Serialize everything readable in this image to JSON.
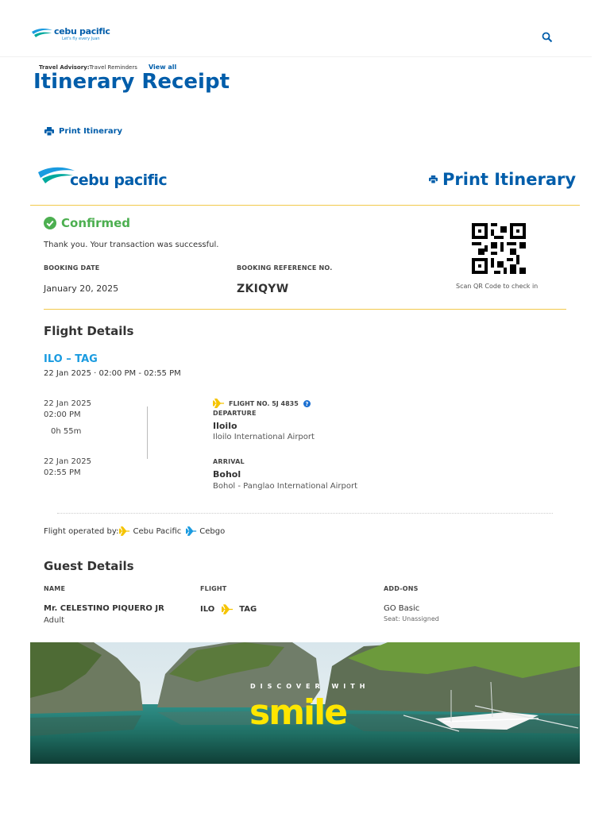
{
  "header": {
    "brand_name": "cebu pacific",
    "brand_tagline": "Let's fly every Juan",
    "advisory_label": "Travel Advisory:",
    "advisory_text": "Travel Reminders",
    "view_all": "View all",
    "brand_color": "#005DAA"
  },
  "page": {
    "title": "Itinerary Receipt",
    "print_link": "Print Itinerary",
    "print_big": "Print Itinerary",
    "brand_name": "cebu pacific"
  },
  "status": {
    "label": "Confirmed",
    "message": "Thank you. Your transaction was successful.",
    "color": "#4CAF50"
  },
  "booking": {
    "date_label": "BOOKING DATE",
    "date": "January 20, 2025",
    "ref_label": "BOOKING REFERENCE NO.",
    "ref": "ZKIQYW",
    "qr_caption": "Scan QR Code to check in"
  },
  "flight_details": {
    "title": "Flight Details",
    "route": "ILO – TAG",
    "summary": "22 Jan 2025 · 02:00 PM - 02:55 PM",
    "departure_date": "22 Jan 2025",
    "departure_time": "02:00 PM",
    "duration": "0h 55m",
    "arrival_date": "22 Jan 2025",
    "arrival_time": "02:55 PM",
    "flight_no": "FLIGHT NO. 5J 4835",
    "departure_label": "DEPARTURE",
    "departure_city": "Iloilo",
    "departure_airport": "Iloilo International Airport",
    "arrival_label": "ARRIVAL",
    "arrival_city": "Bohol",
    "arrival_airport": "Bohol - Panglao International Airport",
    "operated_label": "Flight operated by:",
    "operator1": "Cebu Pacific",
    "operator2": "Cebgo"
  },
  "guest_details": {
    "title": "Guest Details",
    "col_name": "NAME",
    "col_flight": "FLIGHT",
    "col_addons": "ADD-ONS",
    "guest_name": "Mr. CELESTINO PIQUERO JR",
    "guest_type": "Adult",
    "flight_from": "ILO",
    "flight_to": "TAG",
    "addon": "GO Basic",
    "seat": "Seat: Unassigned"
  },
  "banner": {
    "discover": "DISCOVER WITH",
    "smile": "smile"
  },
  "icons": {
    "search": "search-icon",
    "print": "printer-icon",
    "confirmed": "check-circle-icon",
    "plane": "plane-icon",
    "help": "question-icon",
    "qr": "qr-code-icon"
  }
}
